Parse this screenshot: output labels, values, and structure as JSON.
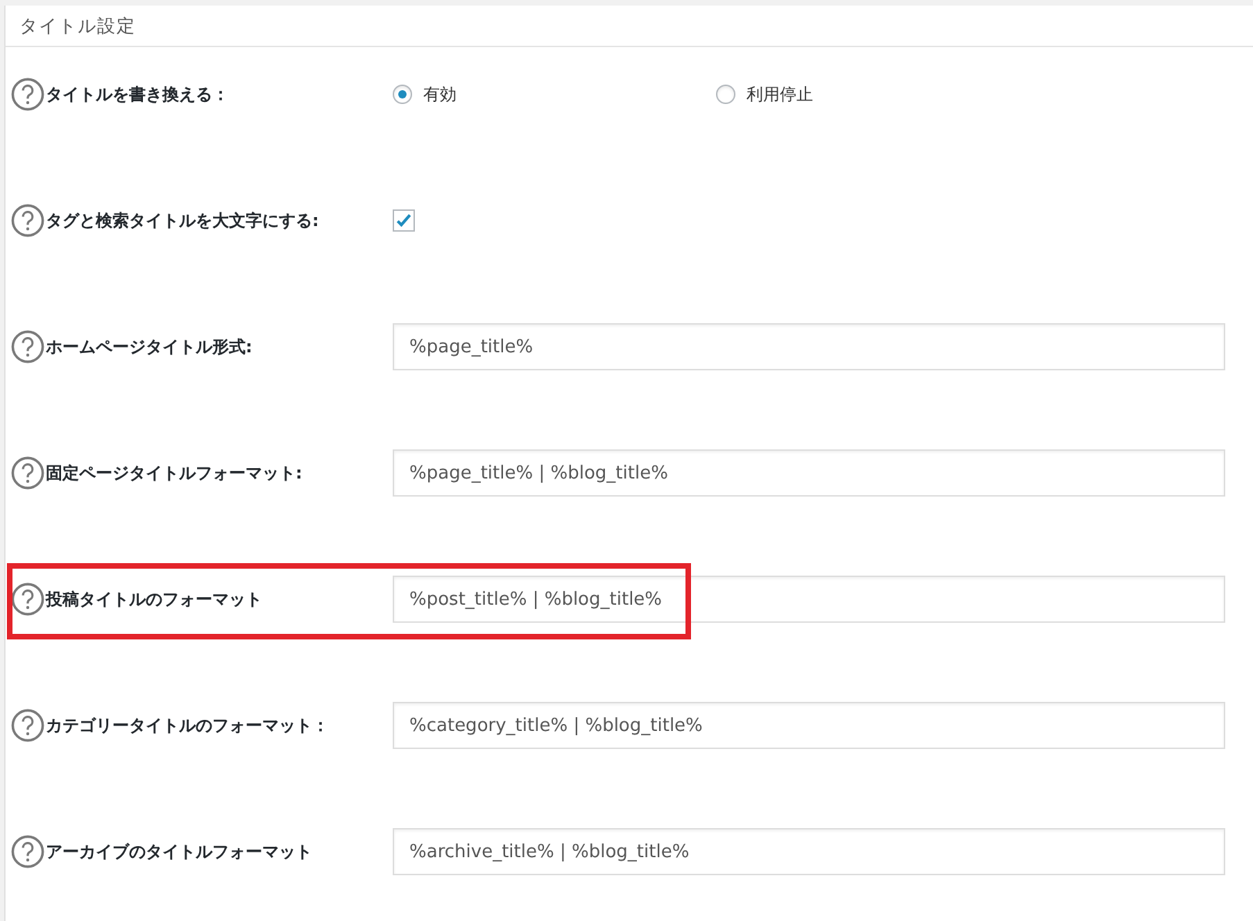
{
  "section": {
    "title": "タイトル設定"
  },
  "rows": [
    {
      "label": "タイトルを書き換える：",
      "kind": "radio",
      "highlighted": false,
      "options": [
        {
          "label": "有効",
          "selected": true
        },
        {
          "label": "利用停止",
          "selected": false
        }
      ]
    },
    {
      "label": "タグと検索タイトルを大文字にする:",
      "kind": "checkbox",
      "highlighted": false,
      "checked": true
    },
    {
      "label": "ホームページタイトル形式:",
      "kind": "text",
      "highlighted": false,
      "value": "%page_title%"
    },
    {
      "label": "固定ページタイトルフォーマット:",
      "kind": "text",
      "highlighted": false,
      "value": "%page_title% | %blog_title%"
    },
    {
      "label": "投稿タイトルのフォーマット",
      "kind": "text",
      "highlighted": true,
      "value": "%post_title% | %blog_title%"
    },
    {
      "label": "カテゴリータイトルのフォーマット：",
      "kind": "text",
      "highlighted": false,
      "value": "%category_title% | %blog_title%"
    },
    {
      "label": "アーカイブのタイトルフォーマット",
      "kind": "text",
      "highlighted": false,
      "value": "%archive_title% | %blog_title%"
    }
  ]
}
